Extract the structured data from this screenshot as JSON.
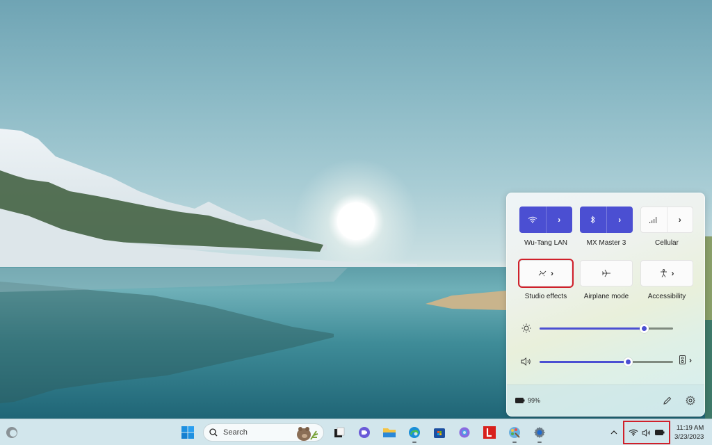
{
  "desktop": {
    "wallpaper": "lake-sunrise-landscape"
  },
  "quick_settings": {
    "tiles": [
      {
        "id": "wifi",
        "label": "Wu-Tang LAN",
        "icon": "wifi-icon",
        "state": "on",
        "has_submenu": true
      },
      {
        "id": "bluetooth",
        "label": "MX Master 3",
        "icon": "bluetooth-icon",
        "state": "on",
        "has_submenu": true
      },
      {
        "id": "cellular",
        "label": "Cellular",
        "icon": "cellular-signal-icon",
        "state": "off",
        "has_submenu": true
      },
      {
        "id": "studio-effects",
        "label": "Studio effects",
        "icon": "studio-effects-icon",
        "state": "off",
        "has_submenu": true,
        "highlighted": true
      },
      {
        "id": "airplane",
        "label": "Airplane mode",
        "icon": "airplane-icon",
        "state": "off",
        "has_submenu": false
      },
      {
        "id": "accessibility",
        "label": "Accessibility",
        "icon": "accessibility-icon",
        "state": "off",
        "has_submenu": true
      }
    ],
    "brightness": {
      "icon": "sun-icon",
      "percent": 78
    },
    "volume": {
      "icon": "speaker-icon",
      "percent": 66,
      "output_icon": "audio-output-device-icon"
    },
    "footer": {
      "battery_text": "99%",
      "battery_icon": "battery-icon",
      "edit_icon": "pencil-icon",
      "settings_icon": "gear-icon"
    },
    "accent_color": "#4b4fd2"
  },
  "taskbar": {
    "widgets_icon": "widgets-weather-icon",
    "start_icon": "windows-start-icon",
    "search": {
      "placeholder": "Search"
    },
    "apps": [
      {
        "name": "task-view",
        "icon": "task-view-icon",
        "running": false
      },
      {
        "name": "teams-chat",
        "icon": "teams-chat-icon",
        "running": false
      },
      {
        "name": "file-explorer",
        "icon": "folder-icon",
        "running": false
      },
      {
        "name": "edge",
        "icon": "edge-browser-icon",
        "running": true
      },
      {
        "name": "microsoft-store",
        "icon": "store-icon",
        "running": false
      },
      {
        "name": "copilot",
        "icon": "copilot-icon",
        "running": false
      },
      {
        "name": "lastpass",
        "icon": "lastpass-icon",
        "running": false
      },
      {
        "name": "paint",
        "icon": "paint-icon",
        "running": true
      },
      {
        "name": "settings",
        "icon": "settings-gear-icon",
        "running": true
      }
    ],
    "tray": {
      "overflow_icon": "chevron-up-icon",
      "status_icons": [
        "wifi-icon",
        "speaker-icon",
        "battery-icon"
      ],
      "time": "11:19 AM",
      "date": "3/23/2023"
    }
  }
}
